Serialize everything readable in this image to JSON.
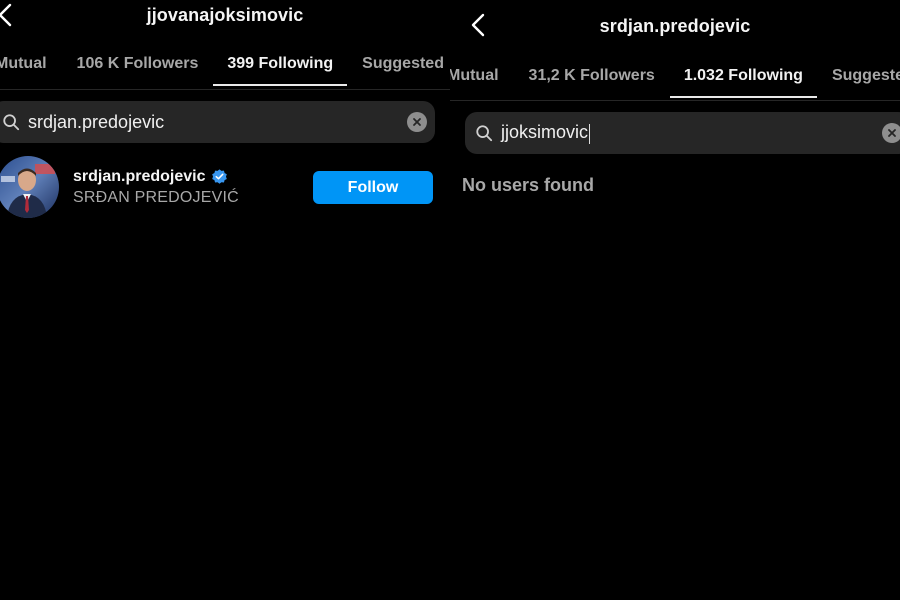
{
  "left": {
    "title": "jjovanajoksimovic",
    "tabs": [
      "Mutual",
      "106 K Followers",
      "399 Following",
      "Suggested"
    ],
    "active_tab": "399 Following",
    "search": {
      "value": "srdjan.predojevic"
    },
    "result": {
      "username": "srdjan.predojevic",
      "full_name": "SRĐAN PREDOJEVIĆ",
      "verified": true,
      "follow_label": "Follow"
    }
  },
  "right": {
    "title": "srdjan.predojevic",
    "tabs": [
      "Mutual",
      "31,2 K Followers",
      "1.032 Following",
      "Suggested"
    ],
    "active_tab": "1.032 Following",
    "search": {
      "value": "jjoksimovic"
    },
    "empty_message": "No users found"
  },
  "colors": {
    "background": "#000000",
    "accent": "#0095f6",
    "verified_badge": "#3897f0",
    "secondary_text": "#a8a8a8",
    "search_bg": "#262626"
  },
  "icons": {
    "back": "chevron-left-icon",
    "search": "search-icon",
    "clear": "close-circle-icon",
    "verified": "verified-badge-icon"
  }
}
